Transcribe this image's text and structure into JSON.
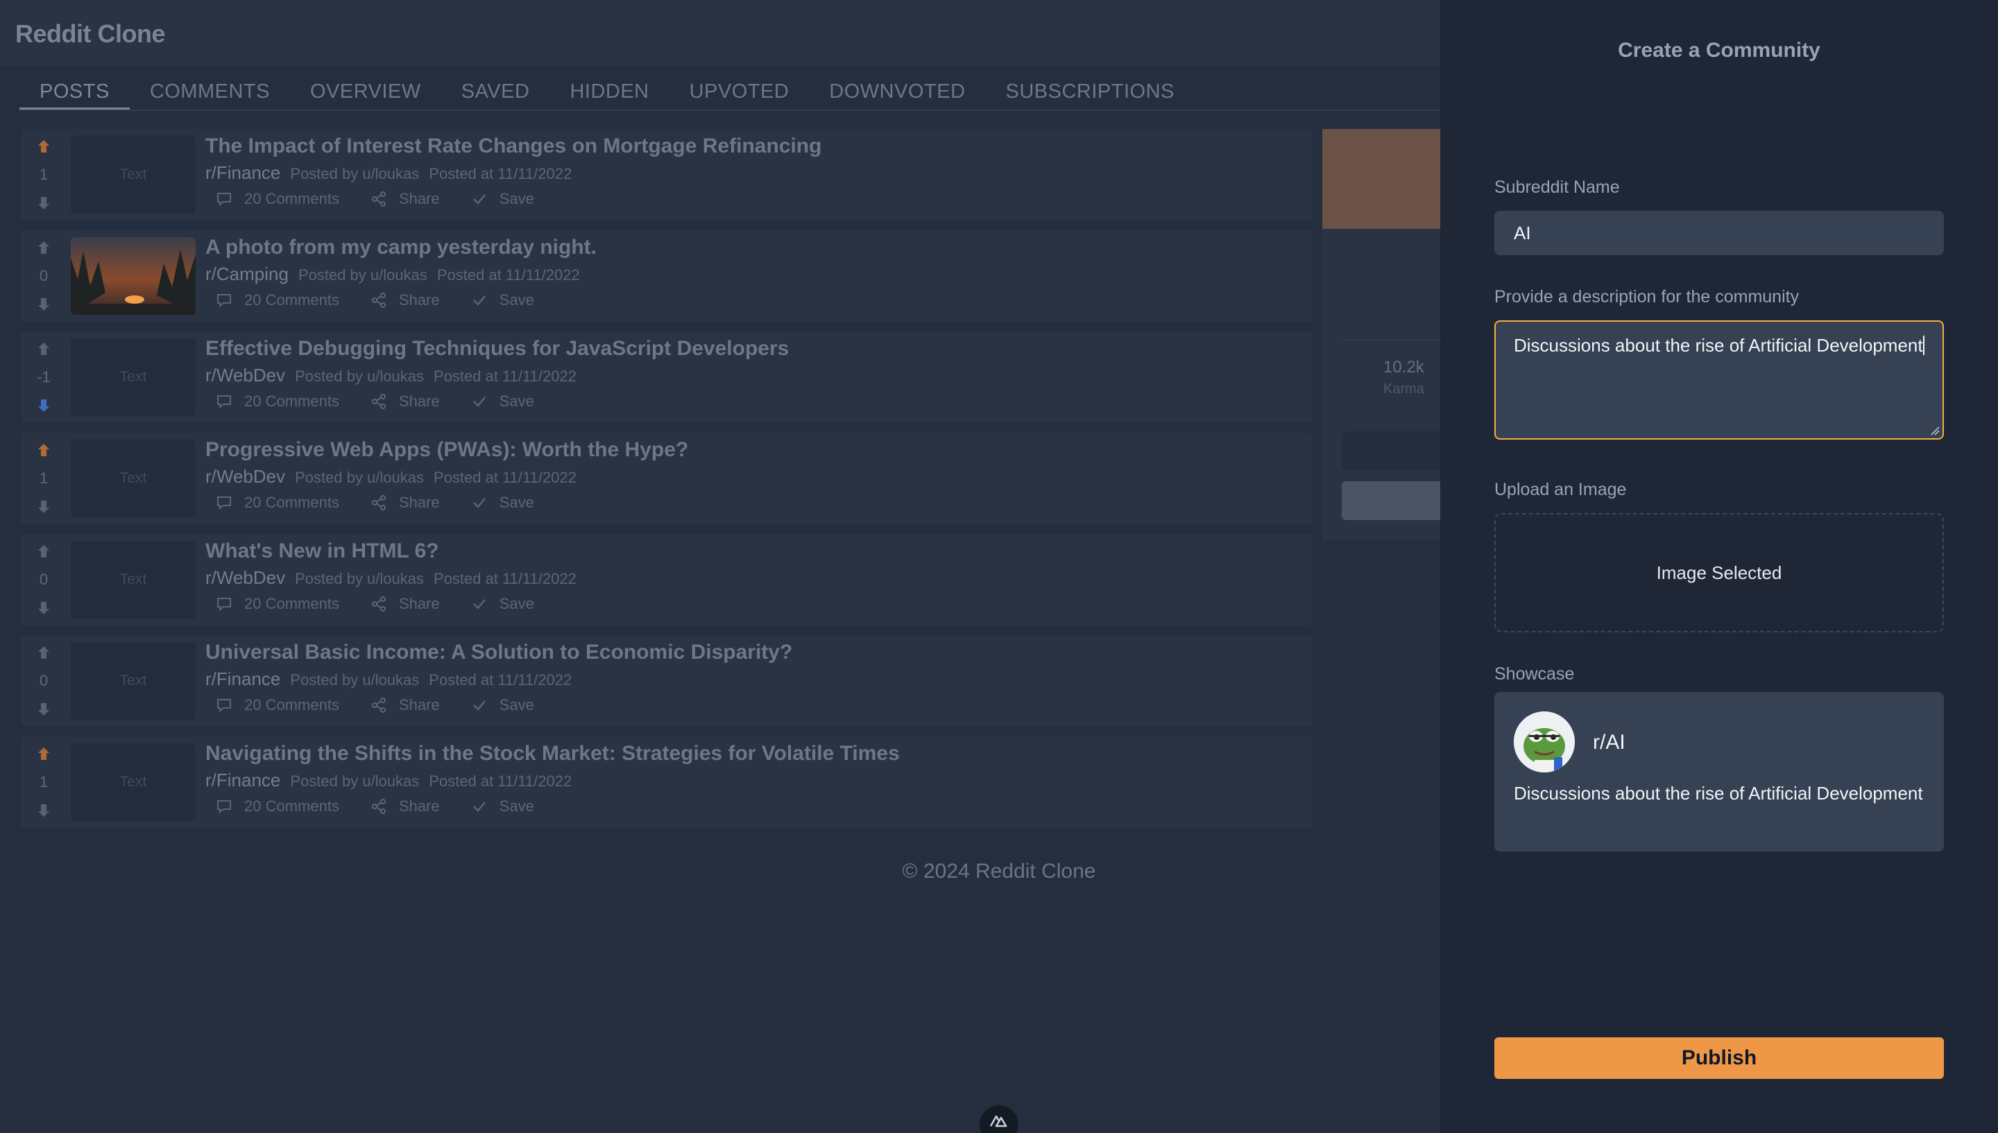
{
  "app": {
    "title": "Reddit Clone"
  },
  "tabs": [
    {
      "label": "POSTS"
    },
    {
      "label": "COMMENTS"
    },
    {
      "label": "OVERVIEW"
    },
    {
      "label": "SAVED"
    },
    {
      "label": "HIDDEN"
    },
    {
      "label": "UPVOTED"
    },
    {
      "label": "DOWNVOTED"
    },
    {
      "label": "SUBSCRIPTIONS"
    }
  ],
  "posts": [
    {
      "votes": "1",
      "vote_state": "up",
      "thumb": "Text",
      "title": "The Impact of Interest Rate Changes on Mortgage Refinancing",
      "subreddit": "r/Finance",
      "posted_by": "Posted by u/loukas",
      "posted_at": "Posted at 11/11/2022",
      "comments": "20 Comments",
      "share": "Share",
      "save": "Save"
    },
    {
      "votes": "0",
      "vote_state": "none",
      "thumb": "",
      "title": "A photo from my camp yesterday night.",
      "subreddit": "r/Camping",
      "posted_by": "Posted by u/loukas",
      "posted_at": "Posted at 11/11/2022",
      "comments": "20 Comments",
      "share": "Share",
      "save": "Save"
    },
    {
      "votes": "-1",
      "vote_state": "down",
      "thumb": "Text",
      "title": "Effective Debugging Techniques for JavaScript Developers",
      "subreddit": "r/WebDev",
      "posted_by": "Posted by u/loukas",
      "posted_at": "Posted at 11/11/2022",
      "comments": "20 Comments",
      "share": "Share",
      "save": "Save"
    },
    {
      "votes": "1",
      "vote_state": "up",
      "thumb": "Text",
      "title": "Progressive Web Apps (PWAs): Worth the Hype?",
      "subreddit": "r/WebDev",
      "posted_by": "Posted by u/loukas",
      "posted_at": "Posted at 11/11/2022",
      "comments": "20 Comments",
      "share": "Share",
      "save": "Save"
    },
    {
      "votes": "0",
      "vote_state": "none",
      "thumb": "Text",
      "title": "What's New in HTML 6?",
      "subreddit": "r/WebDev",
      "posted_by": "Posted by u/loukas",
      "posted_at": "Posted at 11/11/2022",
      "comments": "20 Comments",
      "share": "Share",
      "save": "Save"
    },
    {
      "votes": "0",
      "vote_state": "none",
      "thumb": "Text",
      "title": "Universal Basic Income: A Solution to Economic Disparity?",
      "subreddit": "r/Finance",
      "posted_by": "Posted by u/loukas",
      "posted_at": "Posted at 11/11/2022",
      "comments": "20 Comments",
      "share": "Share",
      "save": "Save"
    },
    {
      "votes": "1",
      "vote_state": "up",
      "thumb": "Text",
      "title": "Navigating the Shifts in the Stock Market: Strategies for Volatile Times",
      "subreddit": "r/Finance",
      "posted_by": "Posted by u/loukas",
      "posted_at": "Posted at 11/11/2022",
      "comments": "20 Comments",
      "share": "Share",
      "save": "Save"
    }
  ],
  "profile_card": {
    "karma_value": "10.2k",
    "karma_label": "Karma"
  },
  "footer": {
    "text": "© 2024 Reddit Clone"
  },
  "modal": {
    "title": "Create a Community",
    "name_label": "Subreddit Name",
    "name_value": "AI",
    "description_label": "Provide a description for the community",
    "description_value": "Discussions about the rise of Artificial Development",
    "upload_label": "Upload an Image",
    "upload_status": "Image Selected",
    "showcase_label": "Showcase",
    "showcase_name": "r/AI",
    "showcase_description": "Discussions about the rise of Artificial Development",
    "publish_label": "Publish"
  },
  "colors": {
    "upvote": "#b06a38",
    "downvote": "#3f6cc4",
    "neutral_vote": "#5a6272",
    "accent": "#ee9847",
    "focus_border": "#f0b23d"
  }
}
